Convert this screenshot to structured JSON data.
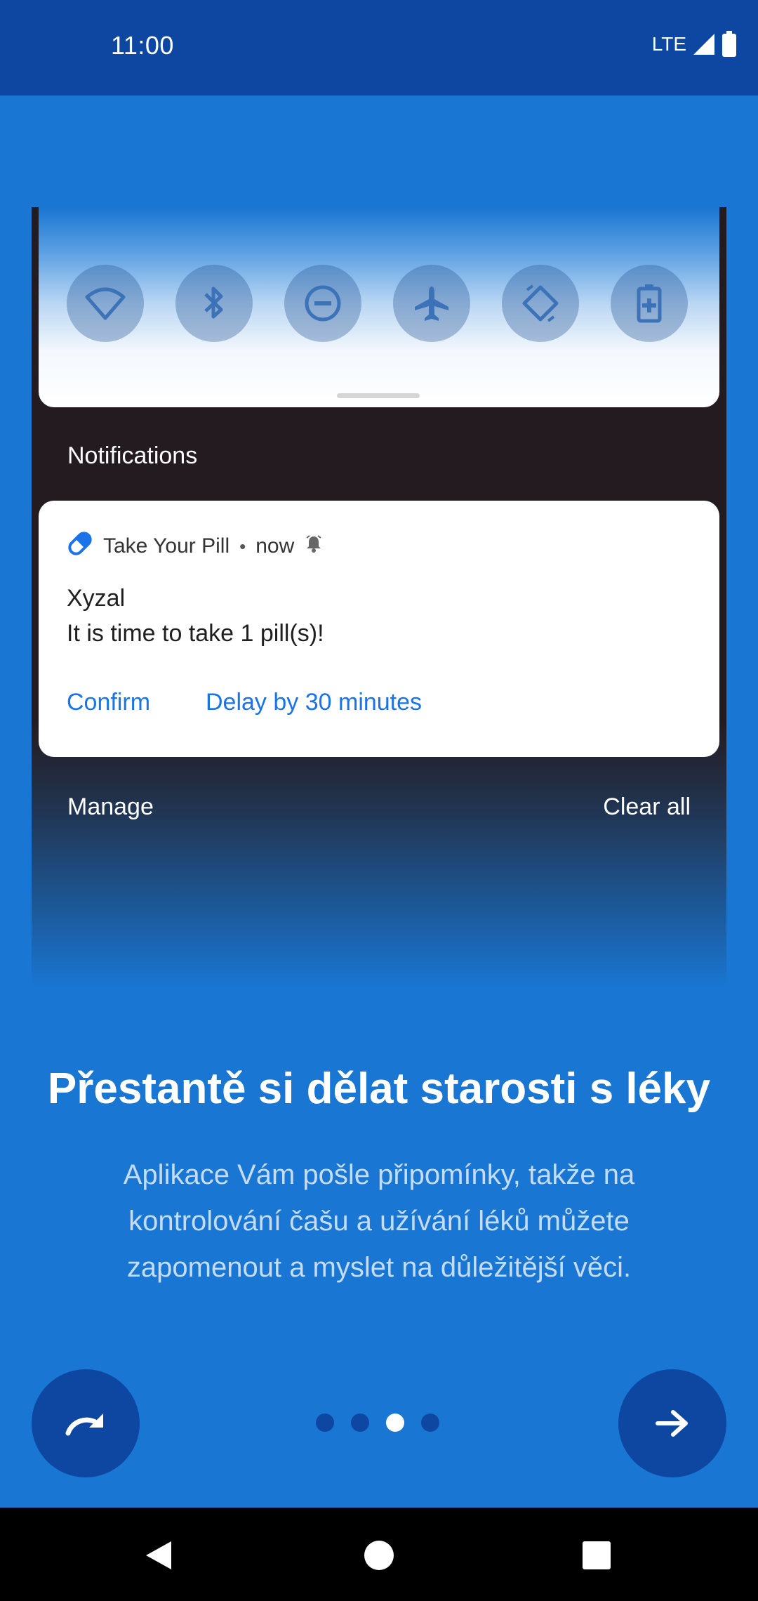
{
  "status_bar": {
    "time": "11:00",
    "network": "LTE"
  },
  "quick_settings": {
    "tiles": [
      "wifi-icon",
      "bluetooth-icon",
      "do-not-disturb-icon",
      "airplane-icon",
      "auto-rotate-icon",
      "battery-saver-icon"
    ]
  },
  "notifications": {
    "header": "Notifications",
    "card": {
      "app_name": "Take Your Pill",
      "time": "now",
      "title": "Xyzal",
      "text": "It is time to take 1 pill(s)!",
      "actions": [
        "Confirm",
        "Delay by 30 minutes"
      ]
    },
    "manage": "Manage",
    "clear_all": "Clear all"
  },
  "onboarding": {
    "headline": "Přestantě si dělat starosti s léky",
    "description": "Aplikace Vám pošle připomínky, takže na kontrolování čašu a užívání léků můžete zapomenout a myslet na důležitější věci.",
    "page_index": 3,
    "page_count": 4
  },
  "colors": {
    "primary": "#1976d2",
    "primary_dark": "#0d47a1",
    "accent": "#1a73e8"
  }
}
